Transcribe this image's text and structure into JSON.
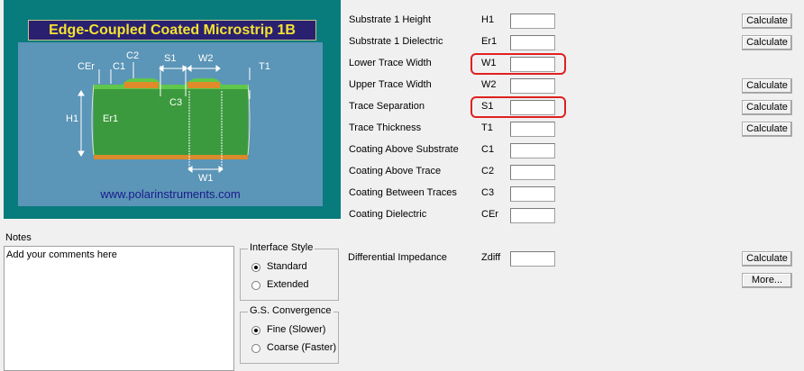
{
  "diagram": {
    "title": "Edge-Coupled Coated Microstrip 1B",
    "url": "www.polarinstruments.com",
    "labels": {
      "cer": "CEr",
      "c1": "C1",
      "c2": "C2",
      "s1": "S1",
      "w2": "W2",
      "t1": "T1",
      "h1": "H1",
      "er1": "Er1",
      "c3": "C3",
      "w1": "W1"
    }
  },
  "params": [
    {
      "label": "Substrate 1 Height",
      "symbol": "H1",
      "value": "",
      "button": "Calculate"
    },
    {
      "label": "Substrate 1 Dielectric",
      "symbol": "Er1",
      "value": "",
      "button": "Calculate"
    },
    {
      "label": "Lower Trace Width",
      "symbol": "W1",
      "value": "",
      "button": ""
    },
    {
      "label": "Upper Trace Width",
      "symbol": "W2",
      "value": "",
      "button": "Calculate"
    },
    {
      "label": "Trace Separation",
      "symbol": "S1",
      "value": "",
      "button": "Calculate"
    },
    {
      "label": "Trace Thickness",
      "symbol": "T1",
      "value": "",
      "button": "Calculate"
    },
    {
      "label": "Coating Above Substrate",
      "symbol": "C1",
      "value": "",
      "button": ""
    },
    {
      "label": "Coating Above Trace",
      "symbol": "C2",
      "value": "",
      "button": ""
    },
    {
      "label": "Coating Between Traces",
      "symbol": "C3",
      "value": "",
      "button": ""
    },
    {
      "label": "Coating Dielectric",
      "symbol": "CEr",
      "value": "",
      "button": ""
    }
  ],
  "impedance": {
    "label": "Differential Impedance",
    "symbol": "Zdiff",
    "value": "",
    "calculate": "Calculate",
    "more": "More..."
  },
  "notes": {
    "label": "Notes",
    "text": "Add your comments here"
  },
  "interface_style": {
    "title": "Interface Style",
    "options": [
      "Standard",
      "Extended"
    ],
    "selected": "Standard"
  },
  "gs_convergence": {
    "title": "G.S. Convergence",
    "options": [
      "Fine (Slower)",
      "Coarse (Faster)"
    ],
    "selected": "Fine (Slower)"
  },
  "highlight_color": "#e02020"
}
